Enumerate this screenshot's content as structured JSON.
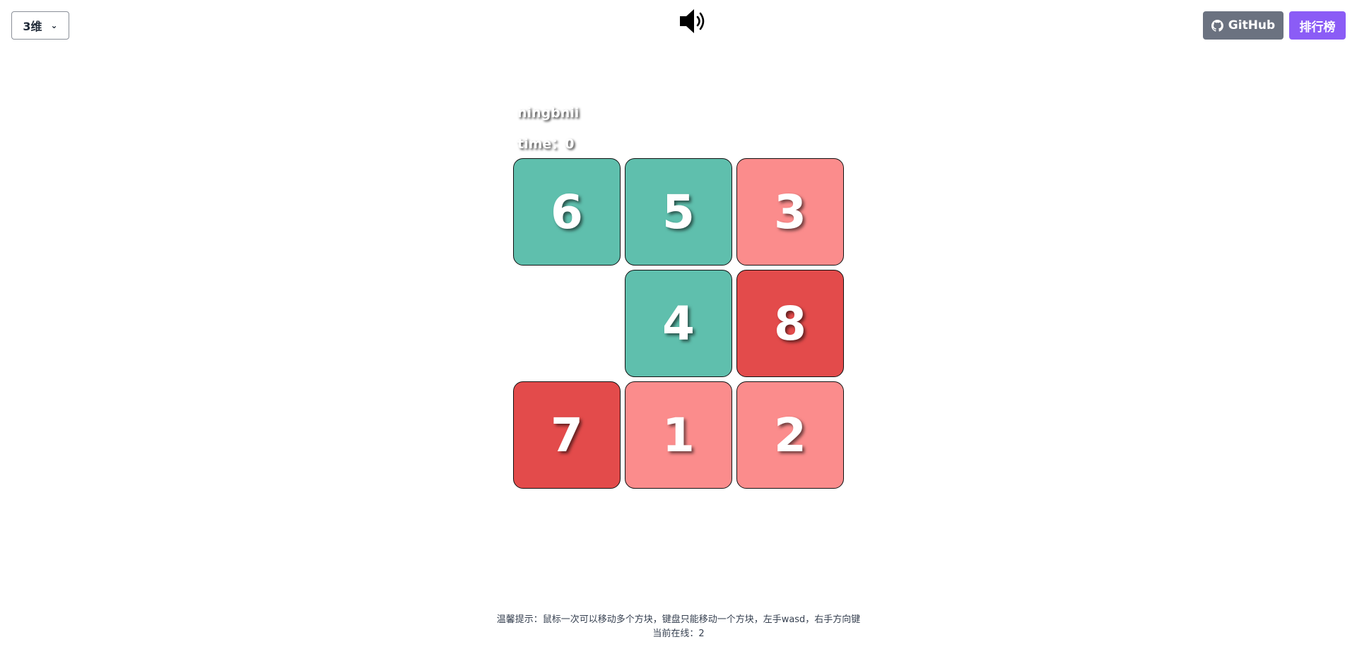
{
  "header": {
    "dimension_select": {
      "value": "3维",
      "options": [
        "3维"
      ]
    },
    "sound_icon": "speaker-on-icon",
    "github_label": "GitHub",
    "rank_label": "排行榜",
    "colors": {
      "github": "#6b7280",
      "rank": "#8b5cf6"
    }
  },
  "player": {
    "name": "ningbnii",
    "time_label": "time：",
    "time_value": "0"
  },
  "board": {
    "size": 3,
    "tiles": [
      {
        "value": "6",
        "color": "teal"
      },
      {
        "value": "5",
        "color": "teal"
      },
      {
        "value": "3",
        "color": "pink"
      },
      {
        "value": "",
        "color": "empty"
      },
      {
        "value": "4",
        "color": "teal"
      },
      {
        "value": "8",
        "color": "red"
      },
      {
        "value": "7",
        "color": "red"
      },
      {
        "value": "1",
        "color": "pink"
      },
      {
        "value": "2",
        "color": "pink"
      }
    ],
    "palette": {
      "teal": "#5fbfad",
      "pink": "#fb8c8c",
      "red": "#e34b4b"
    }
  },
  "footer": {
    "tip": "温馨提示：鼠标一次可以移动多个方块，键盘只能移动一个方块，左手wasd，右手方向键",
    "online_label": "当前在线：",
    "online_count": "2"
  }
}
